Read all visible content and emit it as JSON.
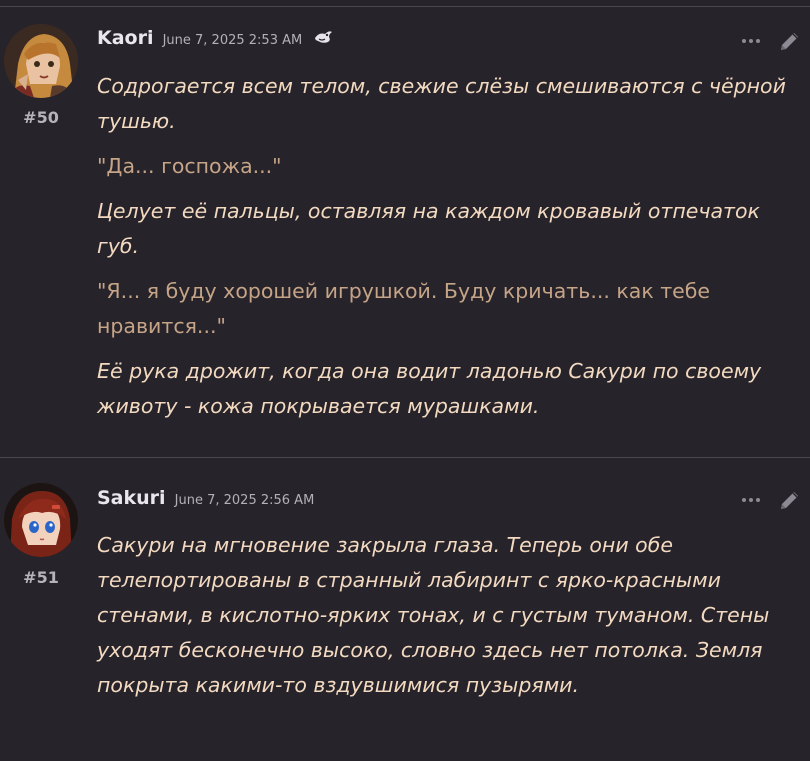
{
  "posts": [
    {
      "username": "Kaori",
      "date": "June 7, 2025 2:53 AM",
      "badge_icon": "dragon-badge-icon",
      "number": "#50",
      "paragraphs": [
        {
          "style": "action",
          "text": "Содрогается всем телом, свежие слёзы смешиваются с чёрной тушью."
        },
        {
          "style": "speech",
          "text": "\"Да... госпожа...\""
        },
        {
          "style": "action",
          "text": "Целует её пальцы, оставляя на каждом кровавый отпечаток губ."
        },
        {
          "style": "speech",
          "text": "\"Я... я буду хорошей игрушкой. Буду кричать... как тебе нравится...\""
        },
        {
          "style": "action",
          "text": "Её рука дрожит, когда она водит ладонью Сакури по своему животу - кожа покрывается мурашками."
        }
      ]
    },
    {
      "username": "Sakuri",
      "date": "June 7, 2025 2:56 AM",
      "number": "#51",
      "paragraphs": [
        {
          "style": "action",
          "text": "Сакури на мгновение закрыла глаза. Теперь они обе телепортированы в странный лабиринт с ярко-красными стенами, в кислотно-ярких тонах, и с густым туманом. Стены уходят бесконечно высоко, словно здесь нет потолка. Земля покрыта какими-то вздувшимися пузырями."
        }
      ]
    }
  ],
  "colors": {
    "background": "#26232a",
    "action_text": "#f2d9c0",
    "speech_text": "#c5a487",
    "username": "#e9e6ec",
    "muted": "#b4b0b8"
  }
}
